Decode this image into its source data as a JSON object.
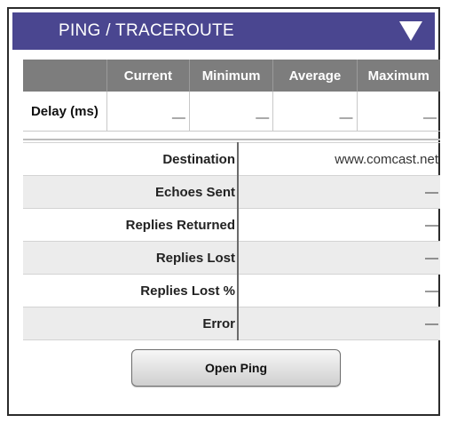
{
  "header": {
    "title": "PING / TRACEROUTE",
    "accent_color": "#4a4690",
    "dropdown_icon": "triangle-down-icon"
  },
  "delay_table": {
    "columns": [
      "",
      "Current",
      "Minimum",
      "Average",
      "Maximum"
    ],
    "row_label": "Delay (ms)",
    "values": [
      "—",
      "—",
      "—",
      "—"
    ]
  },
  "info": {
    "rows": [
      {
        "label": "Destination",
        "value": "www.comcast.net"
      },
      {
        "label": "Echoes Sent",
        "value": "—"
      },
      {
        "label": "Replies Returned",
        "value": "—"
      },
      {
        "label": "Replies Lost",
        "value": "—"
      },
      {
        "label": "Replies Lost %",
        "value": "—"
      },
      {
        "label": "Error",
        "value": "—"
      }
    ]
  },
  "actions": {
    "open_ping_label": "Open Ping"
  }
}
